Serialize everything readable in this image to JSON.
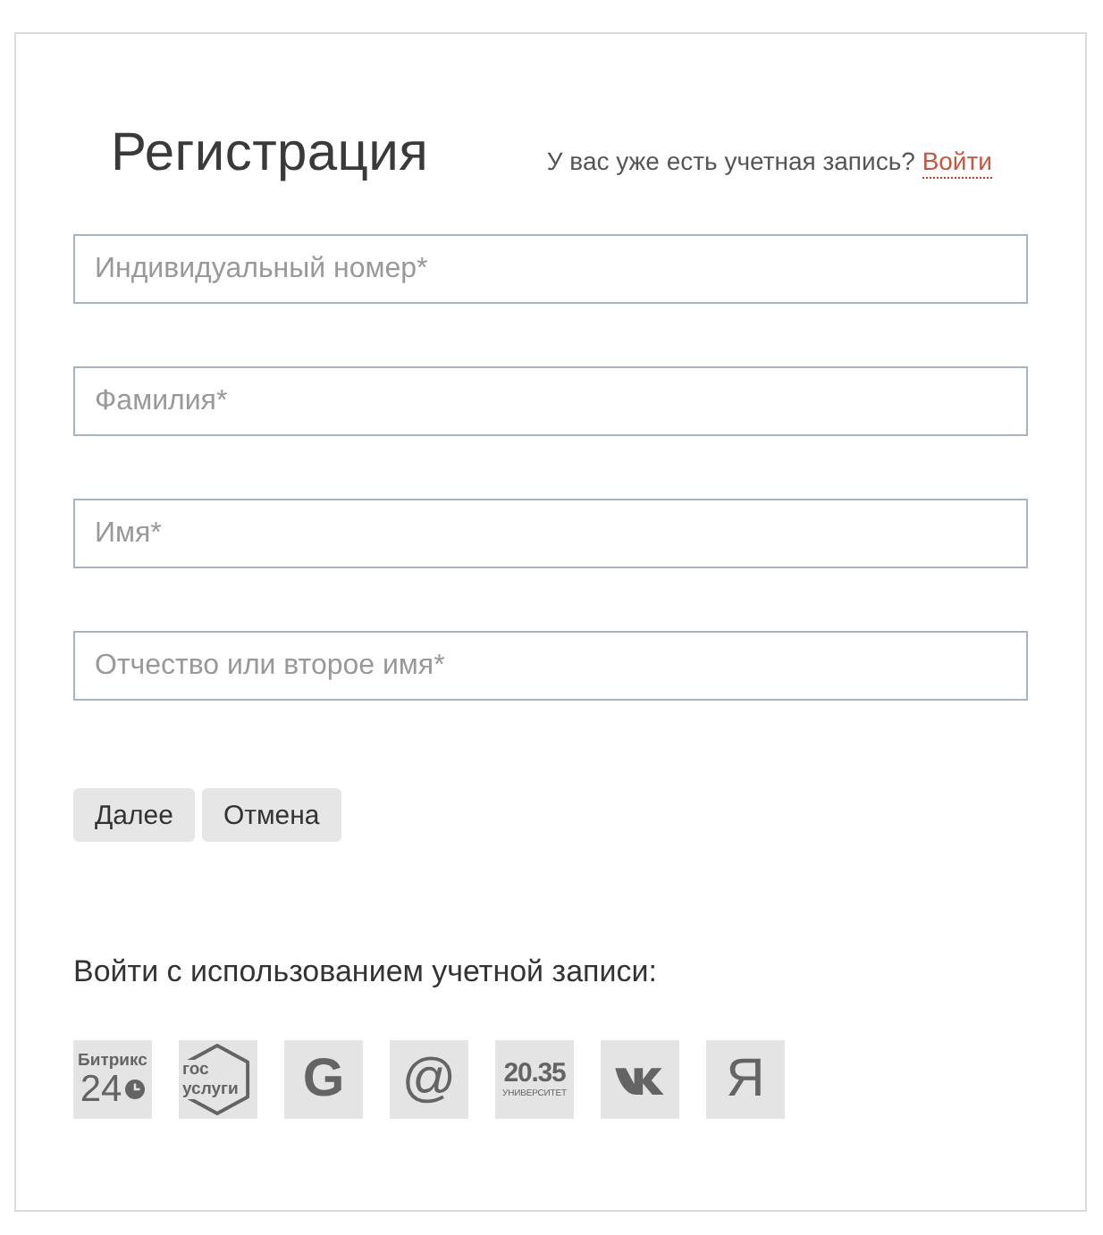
{
  "title": "Регистрация",
  "login_prompt": {
    "text": "У вас уже есть учетная запись?",
    "link": "Войти"
  },
  "fields": [
    {
      "placeholder": "Индивидуальный номер*"
    },
    {
      "placeholder": "Фамилия*"
    },
    {
      "placeholder": "Имя*"
    },
    {
      "placeholder": "Отчество или второе имя*"
    }
  ],
  "buttons": [
    {
      "label": "Далее"
    },
    {
      "label": "Отмена"
    }
  ],
  "social_login": {
    "heading": "Войти с использованием учетной записи:",
    "providers": [
      {
        "kind": "text_clock",
        "lines": [
          "Битрикс",
          "24"
        ]
      },
      {
        "kind": "text_hexagon",
        "lines": [
          "гос",
          "услуги"
        ]
      },
      {
        "kind": "glyph_bold",
        "lines": [
          "G"
        ]
      },
      {
        "kind": "glyph",
        "lines": [
          "@"
        ]
      },
      {
        "kind": "stacked_text",
        "lines": [
          "20.35",
          "УНИВЕРСИТЕТ"
        ]
      },
      {
        "kind": "mark"
      },
      {
        "kind": "glyph",
        "lines": [
          "Я"
        ]
      }
    ]
  }
}
